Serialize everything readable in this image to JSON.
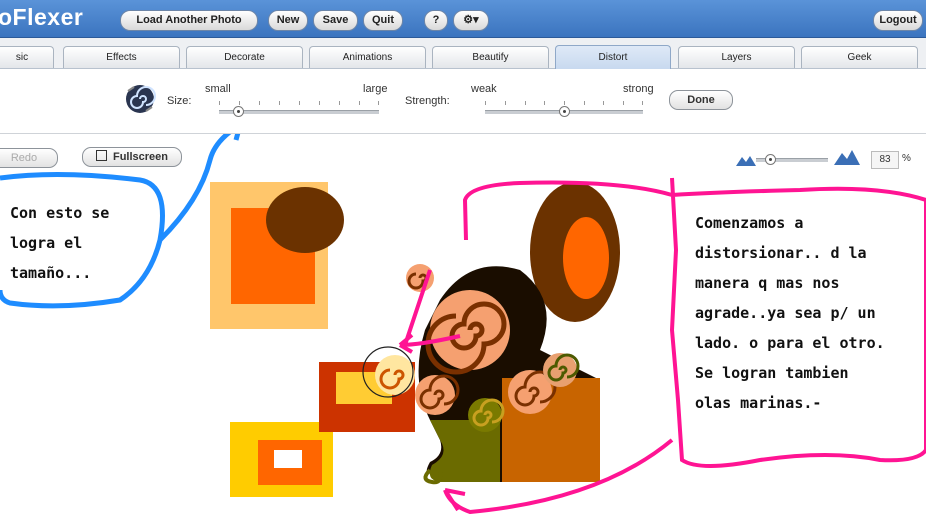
{
  "app": {
    "logo": "oFlexer"
  },
  "top_buttons": [
    {
      "id": "load",
      "label": "Load Another Photo"
    },
    {
      "id": "new",
      "label": "New"
    },
    {
      "id": "save",
      "label": "Save"
    },
    {
      "id": "quit",
      "label": "Quit"
    },
    {
      "id": "help",
      "label": "?"
    },
    {
      "id": "settings",
      "label": "⚙▾"
    }
  ],
  "logout_label": "Logout",
  "tabs": [
    "sic",
    "Effects",
    "Decorate",
    "Animations",
    "Beautify",
    "Distort",
    "Layers",
    "Geek"
  ],
  "active_tab": "Distort",
  "toolbar": {
    "size_label": "Size:",
    "size_min": "small",
    "size_max": "large",
    "size_value": 0.12,
    "strength_label": "Strength:",
    "strength_min": "weak",
    "strength_max": "strong",
    "strength_value": 0.5,
    "done_label": "Done"
  },
  "row2": {
    "redo_label": "Redo",
    "fullscreen_label": "Fullscreen",
    "zoom_value": "83",
    "zoom_unit": "%",
    "zoom_fraction": 0.2
  },
  "annotations": {
    "left": [
      "Con esto se",
      "logra el",
      "tamaño..."
    ],
    "right": [
      "Comenzamos a",
      "distorsionar.. d la",
      "manera q mas nos",
      "agrade..ya sea p/ un",
      "lado. o para el otro.",
      "Se logran tambien",
      "olas marinas.-"
    ]
  },
  "colors": {
    "topbar": "#4a84cc",
    "annot_blue": "#1e8cff",
    "annot_pink": "#ff1493"
  }
}
